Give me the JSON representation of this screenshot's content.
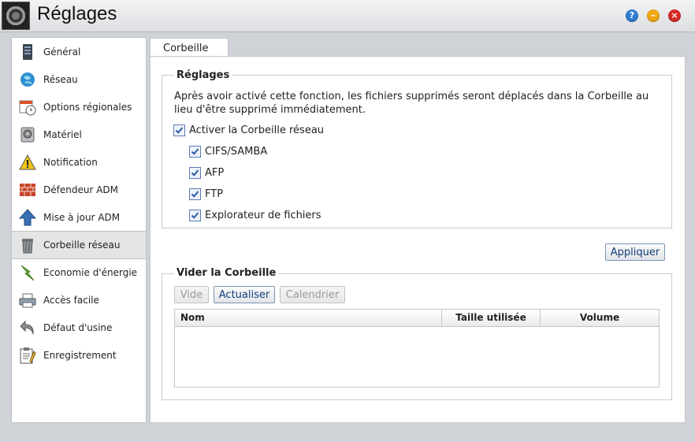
{
  "window": {
    "title": "Réglages",
    "help_button": "?",
    "minimize_button": "–",
    "close_button": "×"
  },
  "sidebar": {
    "items": [
      {
        "label": "Général",
        "icon": "server-icon"
      },
      {
        "label": "Réseau",
        "icon": "globe-icon"
      },
      {
        "label": "Options régionales",
        "icon": "calendar-clock-icon"
      },
      {
        "label": "Matériel",
        "icon": "hard-drive-icon"
      },
      {
        "label": "Notification",
        "icon": "warning-icon"
      },
      {
        "label": "Défendeur ADM",
        "icon": "firewall-icon"
      },
      {
        "label": "Mise à jour ADM",
        "icon": "upload-arrow-icon"
      },
      {
        "label": "Corbeille réseau",
        "icon": "trash-icon",
        "active": true
      },
      {
        "label": "Economie d'énergie",
        "icon": "lightning-icon"
      },
      {
        "label": "Accès facile",
        "icon": "printer-icon"
      },
      {
        "label": "Défaut d'usine",
        "icon": "undo-icon"
      },
      {
        "label": "Enregistrement",
        "icon": "clipboard-icon"
      }
    ]
  },
  "tab": {
    "label": "Corbeille"
  },
  "settings_group": {
    "legend": "Réglages",
    "description": "Après avoir activé cette fonction, les fichiers supprimés seront déplacés dans la Corbeille au lieu d'être supprimé immédiatement.",
    "enable_checkbox": {
      "label": "Activer la Corbeille réseau",
      "checked": true
    },
    "protocols": [
      {
        "label": "CIFS/SAMBA",
        "checked": true
      },
      {
        "label": "AFP",
        "checked": true
      },
      {
        "label": "FTP",
        "checked": true
      },
      {
        "label": "Explorateur de fichiers",
        "checked": true
      }
    ]
  },
  "apply_button": "Appliquer",
  "empty_group": {
    "legend": "Vider la Corbeille",
    "buttons": {
      "empty": "Vide",
      "refresh": "Actualiser",
      "calendar": "Calendrier"
    },
    "table": {
      "columns": [
        "Nom",
        "Taille utilisée",
        "Volume"
      ],
      "rows": []
    }
  },
  "colors": {
    "accent": "#2f7dd1",
    "checkbox": "#3a67b0",
    "close": "#d72a25",
    "minimize": "#f0a915"
  }
}
